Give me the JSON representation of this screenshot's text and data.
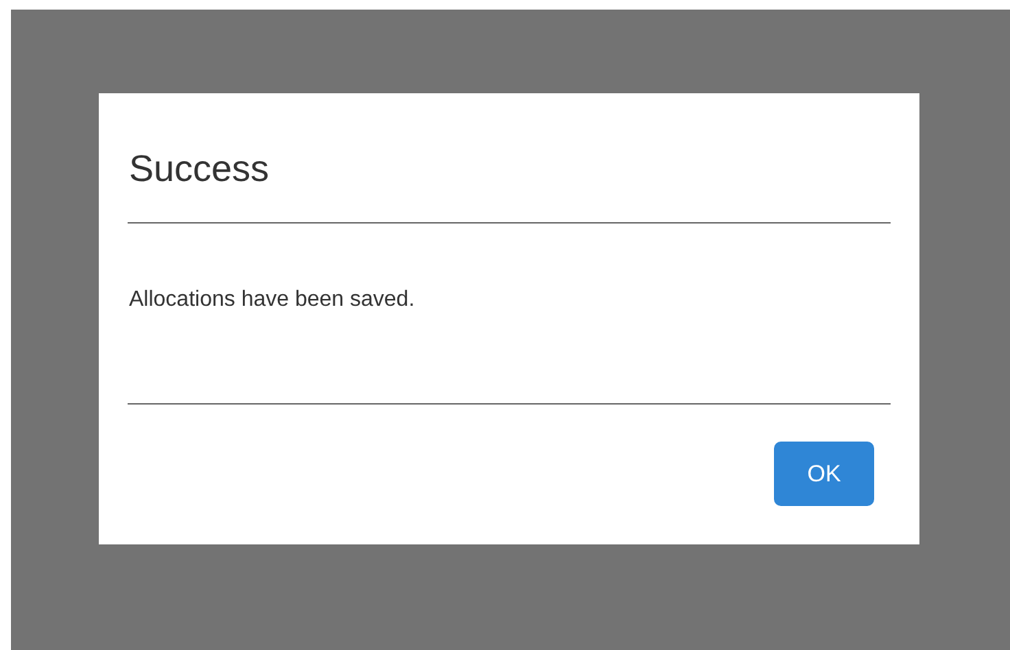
{
  "dialog": {
    "title": "Success",
    "message": "Allocations have been saved.",
    "buttons": [
      "OK"
    ]
  }
}
